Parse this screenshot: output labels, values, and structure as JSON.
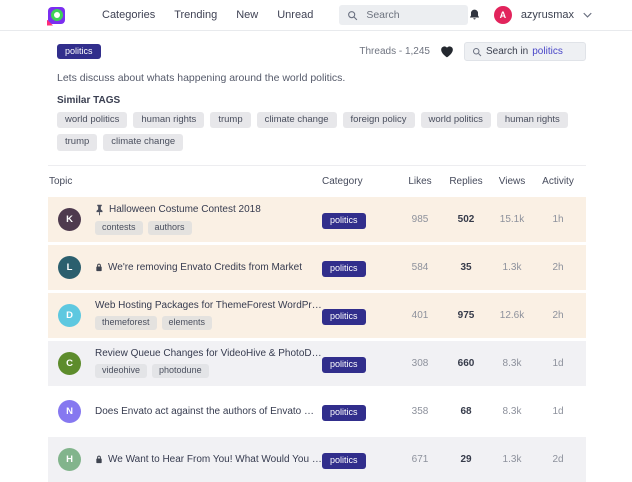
{
  "header": {
    "nav": [
      "Categories",
      "Trending",
      "New",
      "Unread"
    ],
    "search_placeholder": "Search",
    "user": {
      "initial": "A",
      "name": "azyrusmax"
    }
  },
  "intro": {
    "tag": "politics",
    "threads_label": "Threads - 1,245",
    "search_prefix": "Search in",
    "search_highlight": "politics",
    "description": "Lets discuss about whats happening around the world politics.",
    "similar_tags_label": "Similar TAGS",
    "similar_tags": [
      "world politics",
      "human rights",
      "trump",
      "climate change",
      "foreign policy",
      "world politics",
      "human rights",
      "trump",
      "climate change"
    ]
  },
  "table": {
    "columns": [
      "Topic",
      "Category",
      "Likes",
      "Replies",
      "Views",
      "Activity"
    ],
    "rows": [
      {
        "avatar": {
          "initial": "K",
          "color": "#4e3a4e"
        },
        "pinned": true,
        "locked": false,
        "title": "Halloween Costume Contest 2018",
        "tags": [
          "contests",
          "authors"
        ],
        "category": "politics",
        "likes": "985",
        "replies": "502",
        "views": "15.1k",
        "activity": "1h",
        "bg": "peach"
      },
      {
        "avatar": {
          "initial": "L",
          "color": "#2b5f6e"
        },
        "pinned": false,
        "locked": true,
        "title": "We're removing Envato Credits from Market",
        "tags": [],
        "category": "politics",
        "likes": "584",
        "replies": "35",
        "views": "1.3k",
        "activity": "2h",
        "bg": "peach"
      },
      {
        "avatar": {
          "initial": "D",
          "color": "#5ec8e0"
        },
        "pinned": false,
        "locked": false,
        "title": "Web Hosting Packages for ThemeForest WordPress",
        "tags": [
          "themeforest",
          "elements"
        ],
        "category": "politics",
        "likes": "401",
        "replies": "975",
        "views": "12.6k",
        "activity": "2h",
        "bg": "peach"
      },
      {
        "avatar": {
          "initial": "C",
          "color": "#5d8c2c"
        },
        "pinned": false,
        "locked": false,
        "title": "Review Queue Changes for VideoHive & PhotoDune",
        "tags": [
          "videohive",
          "photodune"
        ],
        "category": "politics",
        "likes": "308",
        "replies": "660",
        "views": "8.3k",
        "activity": "1d",
        "bg": "gray"
      },
      {
        "avatar": {
          "initial": "N",
          "color": "#8678f0"
        },
        "pinned": false,
        "locked": false,
        "title": "Does Envato act against the authors of Envato markets?",
        "tags": [],
        "category": "politics",
        "likes": "358",
        "replies": "68",
        "views": "8.3k",
        "activity": "1d",
        "bg": "white"
      },
      {
        "avatar": {
          "initial": "H",
          "color": "#82b48c"
        },
        "pinned": false,
        "locked": true,
        "title": "We Want to Hear From You! What Would You Like?",
        "tags": [],
        "category": "politics",
        "likes": "671",
        "replies": "29",
        "views": "1.3k",
        "activity": "2d",
        "bg": "gray"
      }
    ]
  },
  "colors": {
    "category_badge": "#312e8c",
    "accent_link": "#4946c8",
    "user_avatar": "#e2245c",
    "row_highlight": "#faf0e4",
    "row_alt": "#f1f1f4"
  }
}
